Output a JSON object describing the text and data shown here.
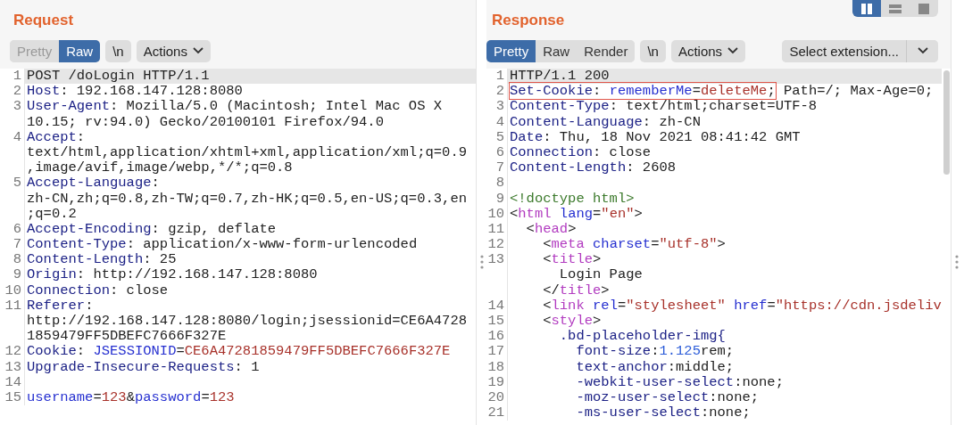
{
  "request": {
    "title": "Request",
    "tabs": [
      {
        "label": "Pretty",
        "selected": false
      },
      {
        "label": "Raw",
        "selected": true
      }
    ],
    "newline_button": "\\n",
    "actions_button": "Actions",
    "lines": [
      {
        "n": "1",
        "highlighted": true,
        "segs": [
          {
            "kind": "text",
            "text": "POST /doLogin HTTP/1.1"
          }
        ]
      },
      {
        "n": "2",
        "highlighted": false,
        "segs": [
          {
            "kind": "key",
            "text": "Host"
          },
          {
            "kind": "text",
            "text": ": 192.168.147.128:8080"
          }
        ]
      },
      {
        "n": "3",
        "highlighted": false,
        "segs": [
          {
            "kind": "key",
            "text": "User-Agent"
          },
          {
            "kind": "text",
            "text": ": Mozilla/5.0 (Macintosh; Intel Mac OS X"
          }
        ]
      },
      {
        "highlighted": false,
        "segs": [
          {
            "kind": "text",
            "text": "10.15; rv:94.0) Gecko/20100101 Firefox/94.0"
          }
        ]
      },
      {
        "n": "4",
        "highlighted": false,
        "segs": [
          {
            "kind": "key",
            "text": "Accept"
          },
          {
            "kind": "text",
            "text": ":"
          }
        ]
      },
      {
        "highlighted": false,
        "segs": [
          {
            "kind": "text",
            "text": "text/html,application/xhtml+xml,application/xml;q=0.9"
          }
        ]
      },
      {
        "highlighted": false,
        "segs": [
          {
            "kind": "text",
            "text": ",image/avif,image/webp,*/*;q=0.8"
          }
        ]
      },
      {
        "n": "5",
        "highlighted": false,
        "segs": [
          {
            "kind": "key",
            "text": "Accept-Language"
          },
          {
            "kind": "text",
            "text": ":"
          }
        ]
      },
      {
        "highlighted": false,
        "segs": [
          {
            "kind": "text",
            "text": "zh-CN,zh;q=0.8,zh-TW;q=0.7,zh-HK;q=0.5,en-US;q=0.3,en"
          }
        ]
      },
      {
        "highlighted": false,
        "segs": [
          {
            "kind": "text",
            "text": ";q=0.2"
          }
        ]
      },
      {
        "n": "6",
        "highlighted": false,
        "segs": [
          {
            "kind": "key",
            "text": "Accept-Encoding"
          },
          {
            "kind": "text",
            "text": ": gzip, deflate"
          }
        ]
      },
      {
        "n": "7",
        "highlighted": false,
        "segs": [
          {
            "kind": "key",
            "text": "Content-Type"
          },
          {
            "kind": "text",
            "text": ": application/x-www-form-urlencoded"
          }
        ]
      },
      {
        "n": "8",
        "highlighted": false,
        "segs": [
          {
            "kind": "key",
            "text": "Content-Length"
          },
          {
            "kind": "text",
            "text": ": 25"
          }
        ]
      },
      {
        "n": "9",
        "highlighted": false,
        "segs": [
          {
            "kind": "key",
            "text": "Origin"
          },
          {
            "kind": "text",
            "text": ": http://192.168.147.128:8080"
          }
        ]
      },
      {
        "n": "10",
        "highlighted": false,
        "segs": [
          {
            "kind": "key",
            "text": "Connection"
          },
          {
            "kind": "text",
            "text": ": close"
          }
        ]
      },
      {
        "n": "11",
        "highlighted": false,
        "segs": [
          {
            "kind": "key",
            "text": "Referer"
          },
          {
            "kind": "text",
            "text": ":"
          }
        ]
      },
      {
        "highlighted": false,
        "segs": [
          {
            "kind": "text",
            "text": "http://192.168.147.128:8080/login;jsessionid=CE6A4728"
          }
        ]
      },
      {
        "highlighted": false,
        "segs": [
          {
            "kind": "text",
            "text": "1859479FF5DBEFC7666F327E"
          }
        ]
      },
      {
        "n": "12",
        "highlighted": false,
        "segs": [
          {
            "kind": "key",
            "text": "Cookie"
          },
          {
            "kind": "text",
            "text": ": "
          },
          {
            "kind": "attr",
            "text": "JSESSIONID"
          },
          {
            "kind": "text",
            "text": "="
          },
          {
            "kind": "value",
            "text": "CE6A47281859479FF5DBEFC7666F327E"
          }
        ]
      },
      {
        "n": "13",
        "highlighted": false,
        "segs": [
          {
            "kind": "key",
            "text": "Upgrade-Insecure-Requests"
          },
          {
            "kind": "text",
            "text": ": 1"
          }
        ]
      },
      {
        "n": "14",
        "highlighted": false
      },
      {
        "n": "15",
        "highlighted": false,
        "segs": [
          {
            "kind": "attr",
            "text": "username"
          },
          {
            "kind": "text",
            "text": "="
          },
          {
            "kind": "value",
            "text": "123"
          },
          {
            "kind": "text",
            "text": "&"
          },
          {
            "kind": "attr",
            "text": "password"
          },
          {
            "kind": "text",
            "text": "="
          },
          {
            "kind": "value",
            "text": "123"
          }
        ]
      }
    ]
  },
  "response": {
    "title": "Response",
    "layout_buttons": [
      {
        "kind": "split",
        "selected": true
      },
      {
        "kind": "stacked",
        "selected": false
      },
      {
        "kind": "single",
        "selected": false
      }
    ],
    "tabs": [
      {
        "label": "Pretty",
        "selected": true
      },
      {
        "label": "Raw",
        "selected": false
      },
      {
        "label": "Render",
        "selected": false
      }
    ],
    "newline_button": "\\n",
    "actions_button": "Actions",
    "extension_select": "Select extension...",
    "lines": [
      {
        "n": "1",
        "highlighted": true,
        "segs": [
          {
            "kind": "text",
            "text": "HTTP/1.1 200"
          }
        ]
      },
      {
        "n": "2",
        "highlighted": false,
        "boxed": [
          {
            "kind": "key",
            "text": "Set-Cookie"
          },
          {
            "kind": "text",
            "text": ": "
          },
          {
            "kind": "attr",
            "text": "rememberMe"
          },
          {
            "kind": "text",
            "text": "="
          },
          {
            "kind": "value",
            "text": "deleteMe"
          },
          {
            "kind": "text",
            "text": ";"
          }
        ],
        "segs": [
          {
            "kind": "text",
            "text": " Path=/; Max-Age=0;"
          }
        ]
      },
      {
        "n": "3",
        "highlighted": false,
        "segs": [
          {
            "kind": "key",
            "text": "Content-Type"
          },
          {
            "kind": "text",
            "text": ": text/html;charset=UTF-8"
          }
        ]
      },
      {
        "n": "4",
        "highlighted": false,
        "segs": [
          {
            "kind": "key",
            "text": "Content-Language"
          },
          {
            "kind": "text",
            "text": ": zh-CN"
          }
        ]
      },
      {
        "n": "5",
        "highlighted": false,
        "segs": [
          {
            "kind": "key",
            "text": "Date"
          },
          {
            "kind": "text",
            "text": ": Thu, 18 Nov 2021 08:41:42 GMT"
          }
        ]
      },
      {
        "n": "6",
        "highlighted": false,
        "segs": [
          {
            "kind": "key",
            "text": "Connection"
          },
          {
            "kind": "text",
            "text": ": close"
          }
        ]
      },
      {
        "n": "7",
        "highlighted": false,
        "segs": [
          {
            "kind": "key",
            "text": "Content-Length"
          },
          {
            "kind": "text",
            "text": ": 2608"
          }
        ]
      },
      {
        "n": "8",
        "highlighted": false
      },
      {
        "n": "9",
        "highlighted": false,
        "segs": [
          {
            "kind": "doctype",
            "text": "<!doctype html>"
          }
        ]
      },
      {
        "n": "10",
        "highlighted": false,
        "segs": [
          {
            "kind": "text",
            "text": "<"
          },
          {
            "kind": "tag",
            "text": "html"
          },
          {
            "kind": "attr",
            "text": " lang"
          },
          {
            "kind": "text",
            "text": "="
          },
          {
            "kind": "value",
            "text": "\"en\""
          },
          {
            "kind": "text",
            "text": ">"
          }
        ]
      },
      {
        "n": "11",
        "highlighted": false,
        "segs": [
          {
            "kind": "text",
            "text": "  <"
          },
          {
            "kind": "tag",
            "text": "head"
          },
          {
            "kind": "text",
            "text": ">"
          }
        ]
      },
      {
        "n": "12",
        "highlighted": false,
        "segs": [
          {
            "kind": "text",
            "text": "    <"
          },
          {
            "kind": "tag",
            "text": "meta"
          },
          {
            "kind": "attr",
            "text": " charset"
          },
          {
            "kind": "text",
            "text": "="
          },
          {
            "kind": "value",
            "text": "\"utf-8\""
          },
          {
            "kind": "text",
            "text": ">"
          }
        ]
      },
      {
        "n": "13",
        "highlighted": false,
        "segs": [
          {
            "kind": "text",
            "text": "    <"
          },
          {
            "kind": "tag",
            "text": "title"
          },
          {
            "kind": "text",
            "text": ">"
          }
        ]
      },
      {
        "highlighted": false,
        "segs": [
          {
            "kind": "text",
            "text": "      Login Page"
          }
        ]
      },
      {
        "highlighted": false,
        "segs": [
          {
            "kind": "text",
            "text": "    </"
          },
          {
            "kind": "tag",
            "text": "title"
          },
          {
            "kind": "text",
            "text": ">"
          }
        ]
      },
      {
        "n": "14",
        "highlighted": false,
        "segs": [
          {
            "kind": "text",
            "text": "    <"
          },
          {
            "kind": "tag",
            "text": "link"
          },
          {
            "kind": "attr",
            "text": " rel"
          },
          {
            "kind": "text",
            "text": "="
          },
          {
            "kind": "value",
            "text": "\"stylesheet\""
          },
          {
            "kind": "attr",
            "text": " href"
          },
          {
            "kind": "text",
            "text": "="
          },
          {
            "kind": "value",
            "text": "\"https://cdn.jsdeliv"
          }
        ]
      },
      {
        "n": "15",
        "highlighted": false,
        "segs": [
          {
            "kind": "text",
            "text": "    <"
          },
          {
            "kind": "tag",
            "text": "style"
          },
          {
            "kind": "text",
            "text": ">"
          }
        ]
      },
      {
        "n": "16",
        "highlighted": false,
        "segs": [
          {
            "kind": "key",
            "text": "      .bd-placeholder-img{"
          }
        ]
      },
      {
        "n": "17",
        "highlighted": false,
        "segs": [
          {
            "kind": "key",
            "text": "        font-size"
          },
          {
            "kind": "text",
            "text": ":"
          },
          {
            "kind": "number",
            "text": "1.125"
          },
          {
            "kind": "text",
            "text": "rem;"
          }
        ]
      },
      {
        "n": "18",
        "highlighted": false,
        "segs": [
          {
            "kind": "key",
            "text": "        text-anchor"
          },
          {
            "kind": "text",
            "text": ":middle;"
          }
        ]
      },
      {
        "n": "19",
        "highlighted": false,
        "segs": [
          {
            "kind": "key",
            "text": "        -webkit-user-select"
          },
          {
            "kind": "text",
            "text": ":none;"
          }
        ]
      },
      {
        "n": "20",
        "highlighted": false,
        "segs": [
          {
            "kind": "key",
            "text": "        -moz-user-select"
          },
          {
            "kind": "text",
            "text": ":none;"
          }
        ]
      },
      {
        "n": "21",
        "highlighted": false,
        "segs": [
          {
            "kind": "key",
            "text": "        -ms-user-select"
          },
          {
            "kind": "text",
            "text": ":none;"
          }
        ]
      }
    ]
  }
}
